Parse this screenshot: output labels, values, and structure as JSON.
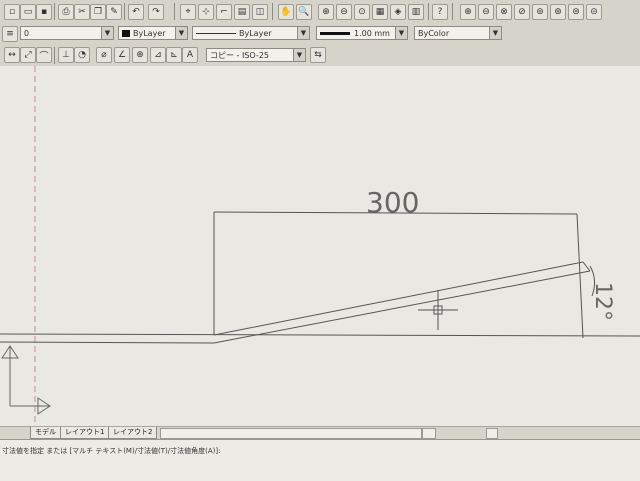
{
  "toolbar": {
    "zoom_icons_count": "",
    "help_glyph": "?"
  },
  "properties": {
    "layer_value": "0",
    "color_value": "ByLayer",
    "linetype_value": "ByLayer",
    "lineweight_value": "1.00 mm",
    "plotstyle_value": "ByColor"
  },
  "dimstyle": {
    "value": "コピー - ISO-25"
  },
  "drawing": {
    "dimension_text": "300",
    "angle_text": "12°"
  },
  "tabs": [
    {
      "label": "モデル"
    },
    {
      "label": "レイアウト1"
    },
    {
      "label": "レイアウト2"
    }
  ],
  "command": {
    "line1": "寸法値を指定 または [マルチ テキスト(M)/寸法値(T)/寸法値角度(A)]:",
    "line2": ""
  }
}
